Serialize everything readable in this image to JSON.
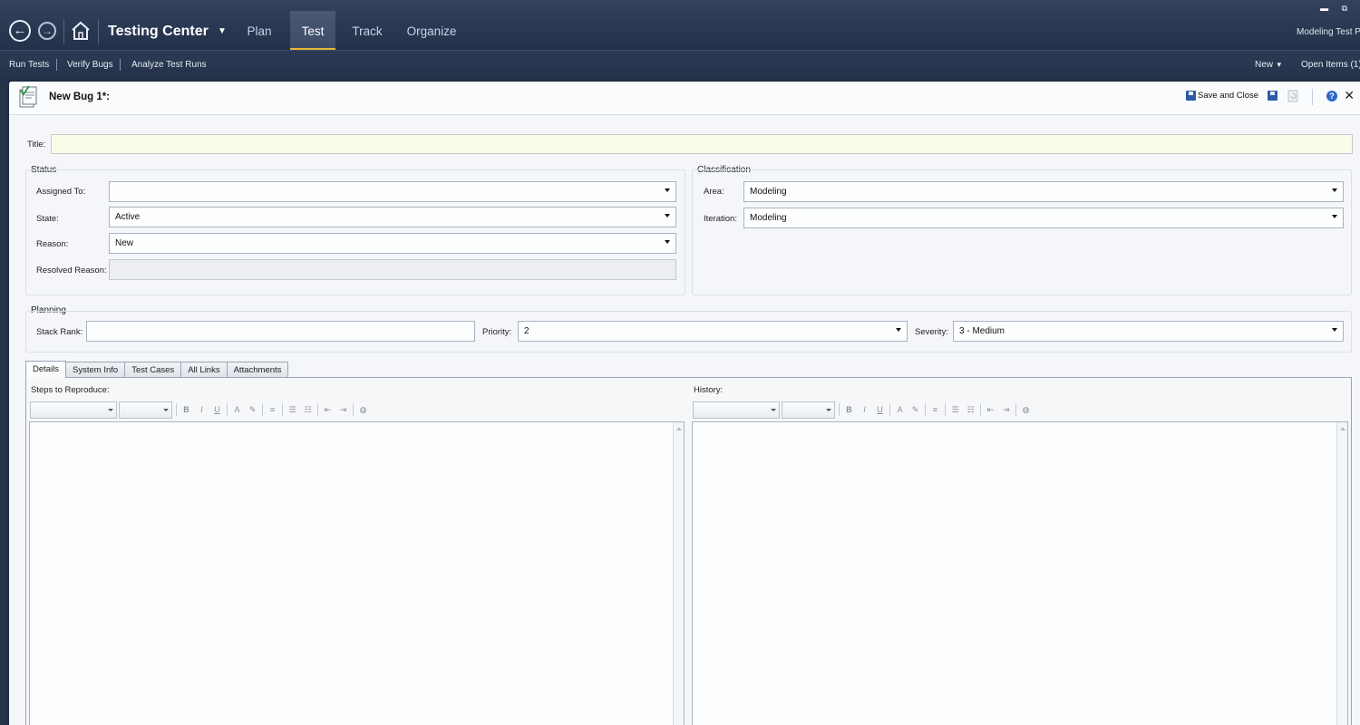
{
  "header": {
    "back_icon": "back-arrow-icon",
    "forward_icon": "forward-arrow-icon",
    "home_icon": "home-icon",
    "app_title": "Testing Center",
    "tabs": [
      {
        "label": "Plan"
      },
      {
        "label": "Test"
      },
      {
        "label": "Track"
      },
      {
        "label": "Organize"
      }
    ],
    "active_tab": "Test",
    "project_name": "Modeling Test P",
    "window_buttons": "▬ ⧉"
  },
  "subnav": {
    "items": [
      {
        "label": "Run Tests"
      },
      {
        "label": "Verify Bugs"
      },
      {
        "label": "Analyze Test Runs"
      }
    ],
    "new_label": "New",
    "open_items_label": "Open Items (1)"
  },
  "document": {
    "title": "New Bug 1*:",
    "save_close_label": "Save and Close",
    "help_icon": "?",
    "close_icon": "✕"
  },
  "form": {
    "title_label": "Title:",
    "title_value": "",
    "status": {
      "group_label": "Status",
      "assigned_to_label": "Assigned To:",
      "assigned_to_value": "",
      "state_label": "State:",
      "state_value": "Active",
      "reason_label": "Reason:",
      "reason_value": "New",
      "resolved_reason_label": "Resolved Reason:",
      "resolved_reason_value": ""
    },
    "classification": {
      "group_label": "Classification",
      "area_label": "Area:",
      "area_value": "Modeling",
      "iteration_label": "Iteration:",
      "iteration_value": "Modeling"
    },
    "planning": {
      "group_label": "Planning",
      "stack_rank_label": "Stack Rank:",
      "stack_rank_value": "",
      "priority_label": "Priority:",
      "priority_value": "2",
      "severity_label": "Severity:",
      "severity_value": "3 - Medium"
    }
  },
  "details_tabs": [
    {
      "label": "Details"
    },
    {
      "label": "System Info"
    },
    {
      "label": "Test Cases"
    },
    {
      "label": "All Links"
    },
    {
      "label": "Attachments"
    }
  ],
  "details": {
    "steps_label": "Steps to Reproduce:",
    "history_label": "History:",
    "toolbar": {
      "bold": "B",
      "italic": "I",
      "underline": "U",
      "font_color_icon": "A",
      "highlight_icon": "✎",
      "align_icon": "≡",
      "bullets_icon": "☰",
      "numbering_icon": "☷",
      "outdent_icon": "⇤",
      "indent_icon": "⇥",
      "image_icon": "◍"
    }
  },
  "colors": {
    "header_bg": "#2a3853",
    "active_tab_underline": "#e6b93a",
    "title_field_bg": "#fbfce8",
    "document_bg": "#f4f6f9"
  }
}
